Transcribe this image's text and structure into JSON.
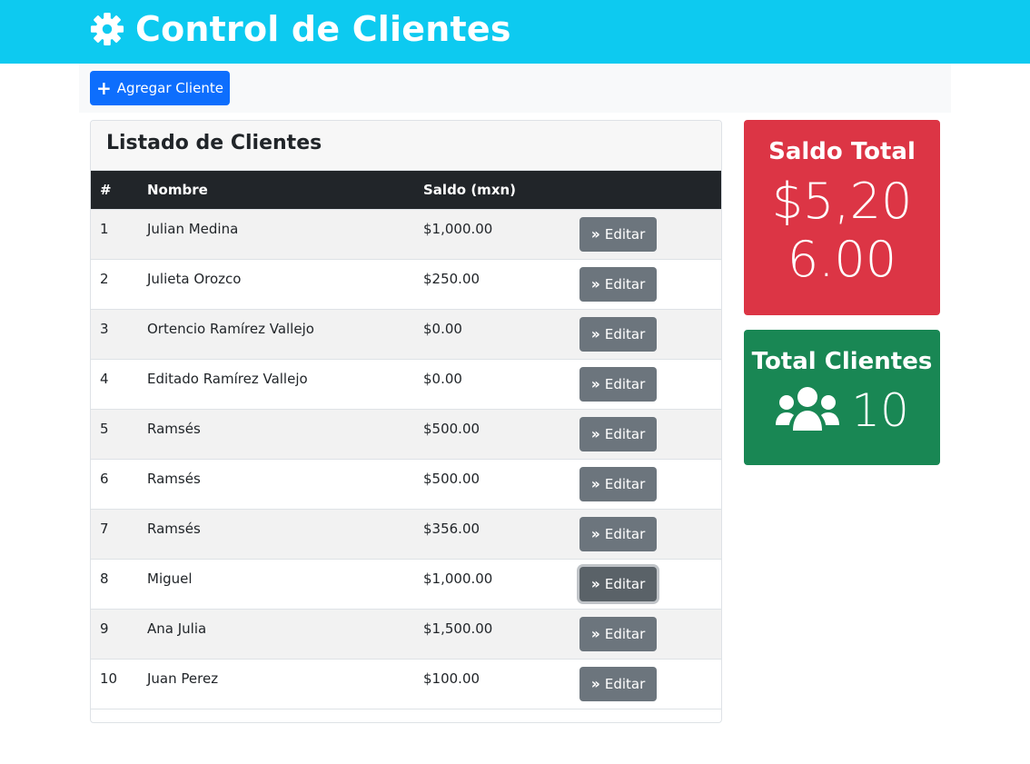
{
  "colors": {
    "header": "#0dcaf0",
    "primary": "#0d6efd",
    "dark": "#212529",
    "secondary": "#6c757d",
    "danger": "#dc3545",
    "success": "#198754"
  },
  "header": {
    "title": "Control de Clientes",
    "icon": "gear-icon"
  },
  "actions": {
    "add_label": "Agregar Cliente",
    "add_icon": "plus-icon"
  },
  "list": {
    "title": "Listado de Clientes",
    "columns": [
      "#",
      "Nombre",
      "Saldo (mxn)",
      ""
    ],
    "rows": [
      {
        "num": "1",
        "nombre": "Julian Medina",
        "saldo": "$1,000.00",
        "action": "Editar"
      },
      {
        "num": "2",
        "nombre": "Julieta Orozco",
        "saldo": "$250.00",
        "action": "Editar"
      },
      {
        "num": "3",
        "nombre": "Ortencio Ramírez Vallejo",
        "saldo": "$0.00",
        "action": "Editar"
      },
      {
        "num": "4",
        "nombre": "Editado Ramírez Vallejo",
        "saldo": "$0.00",
        "action": "Editar"
      },
      {
        "num": "5",
        "nombre": "Ramsés",
        "saldo": "$500.00",
        "action": "Editar"
      },
      {
        "num": "6",
        "nombre": "Ramsés",
        "saldo": "$500.00",
        "action": "Editar"
      },
      {
        "num": "7",
        "nombre": "Ramsés",
        "saldo": "$356.00",
        "action": "Editar"
      },
      {
        "num": "8",
        "nombre": "Miguel",
        "saldo": "$1,000.00",
        "action": "Editar",
        "focused": true
      },
      {
        "num": "9",
        "nombre": "Ana Julia",
        "saldo": "$1,500.00",
        "action": "Editar"
      },
      {
        "num": "10",
        "nombre": "Juan Perez",
        "saldo": "$100.00",
        "action": "Editar"
      }
    ]
  },
  "stats": {
    "saldo": {
      "title": "Saldo Total",
      "value": "$5,206.00"
    },
    "clientes": {
      "title": "Total Clientes",
      "value": "10",
      "icon": "users-icon"
    }
  }
}
